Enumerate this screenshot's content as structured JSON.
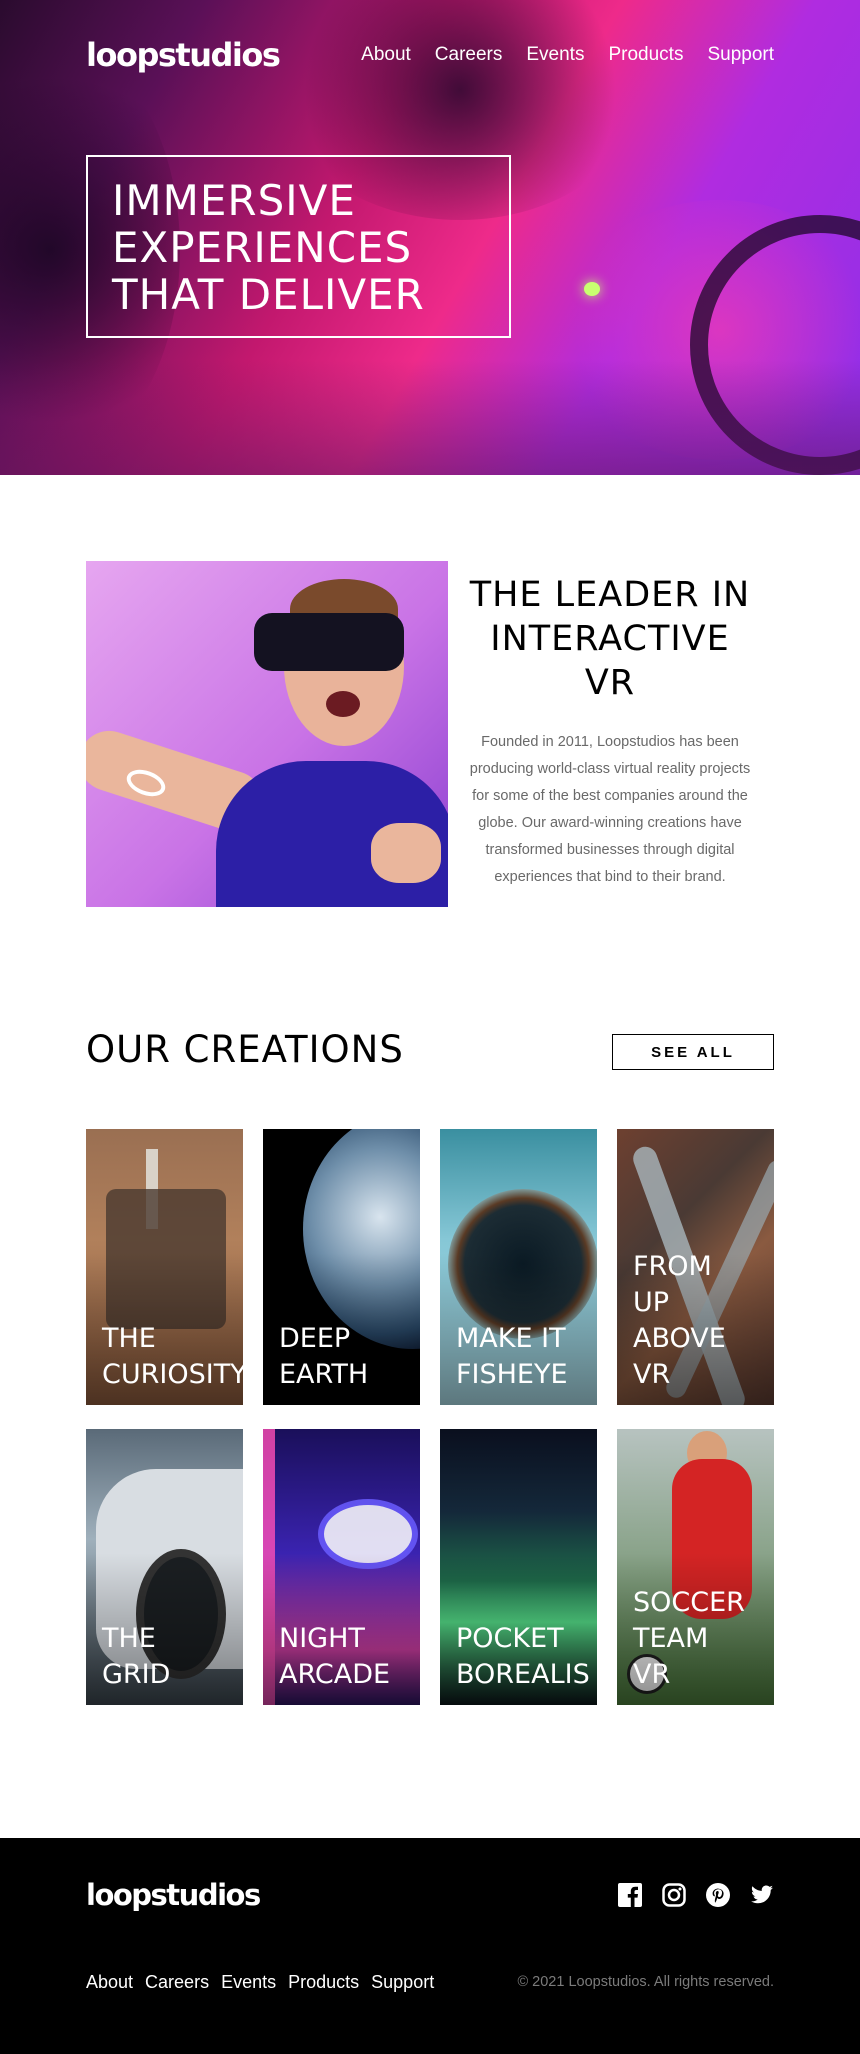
{
  "header": {
    "logo": "loopstudios",
    "nav": [
      "About",
      "Careers",
      "Events",
      "Products",
      "Support"
    ]
  },
  "hero": {
    "headline": "IMMERSIVE EXPERIENCES THAT DELIVER"
  },
  "leader": {
    "title": "THE LEADER IN INTERACTIVE VR",
    "body": "Founded in 2011, Loopstudios has been producing world-class virtual reality projects for some of the best companies around the globe. Our award-winning creations have transformed businesses through digital experiences that bind to their brand."
  },
  "creations": {
    "title": "OUR CREATIONS",
    "see_all": "SEE ALL",
    "items": [
      {
        "title": "THE\nCURIOSITY"
      },
      {
        "title": "DEEP\nEARTH"
      },
      {
        "title": "MAKE IT\nFISHEYE"
      },
      {
        "title": "FROM\nUP\nABOVE\nVR"
      },
      {
        "title": "THE\nGRID"
      },
      {
        "title": "NIGHT\nARCADE"
      },
      {
        "title": "POCKET\nBOREALIS"
      },
      {
        "title": "SOCCER\nTEAM\nVR"
      }
    ]
  },
  "footer": {
    "logo": "loopstudios",
    "nav": [
      "About",
      "Careers",
      "Events",
      "Products",
      "Support"
    ],
    "copyright": "© 2021 Loopstudios. All rights reserved.",
    "social_icons": [
      "facebook-icon",
      "instagram-icon",
      "pinterest-icon",
      "twitter-icon"
    ]
  },
  "colors": {
    "text_dark": "#000000",
    "text_gray": "#696969",
    "footer_bg": "#000000",
    "footer_muted": "#7b7b7b"
  }
}
